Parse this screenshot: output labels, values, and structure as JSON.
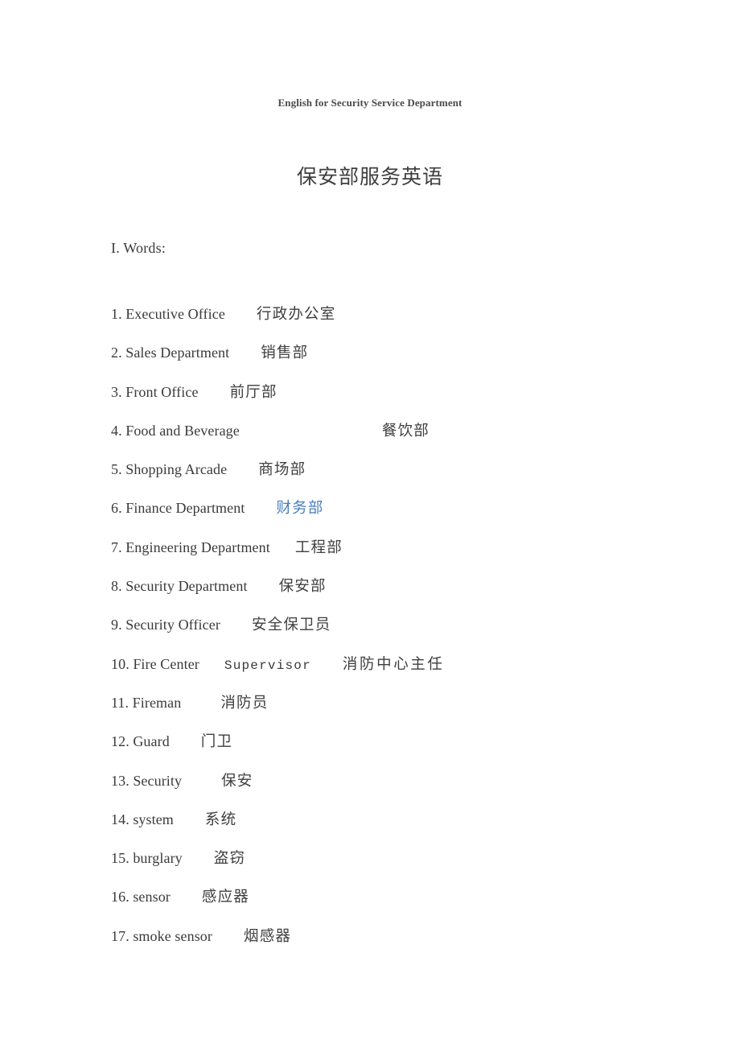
{
  "document": {
    "running_header": "English for Security Service Department",
    "title": "保安部服务英语",
    "section_heading": "I. Words:",
    "accent_color": "#4a7ebb",
    "body_color": "#3a3a3a"
  },
  "words": [
    {
      "num": "1.",
      "en": "Executive Office",
      "zh": "行政办公室"
    },
    {
      "num": "2.",
      "en": "Sales Department",
      "zh": "销售部"
    },
    {
      "num": "3.",
      "en": "Front Office",
      "zh": "前厅部"
    },
    {
      "num": "4.",
      "en": "Food and Beverage",
      "zh": "餐饮部"
    },
    {
      "num": "5.",
      "en": "Shopping Arcade",
      "zh": "商场部"
    },
    {
      "num": "6.",
      "en": "Finance Department",
      "zh": "财务部"
    },
    {
      "num": "7.",
      "en": "Engineering Department",
      "zh": "工程部"
    },
    {
      "num": "8.",
      "en": "Security Department",
      "zh": "保安部"
    },
    {
      "num": "9.",
      "en": "Security Officer",
      "zh": "安全保卫员"
    },
    {
      "num": "10.",
      "en": "Fire Center",
      "en2": "Supervisor",
      "zh": "消防中心主任"
    },
    {
      "num": "11.",
      "en": "Fireman",
      "zh": "消防员"
    },
    {
      "num": "12.",
      "en": "Guard",
      "zh": "门卫"
    },
    {
      "num": "13.",
      "en": "Security",
      "zh": "保安"
    },
    {
      "num": "14.",
      "en": "system",
      "zh": "系统"
    },
    {
      "num": "15.",
      "en": "burglary",
      "zh": "盗窃"
    },
    {
      "num": "16.",
      "en": "sensor",
      "zh": "感应器"
    },
    {
      "num": "17.",
      "en": "smoke sensor",
      "zh": "烟感器"
    }
  ]
}
